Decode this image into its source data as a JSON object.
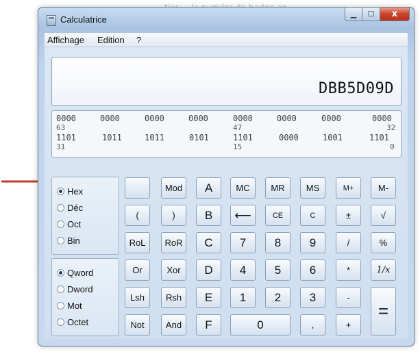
{
  "background_text": "tier ... le numéro de badge en ...",
  "window": {
    "title": "Calculatrice",
    "close_glyph": "x"
  },
  "menubar": [
    "Affichage",
    "Edition",
    "?"
  ],
  "display": {
    "value": "DBB5D09D"
  },
  "bits": {
    "row1": [
      "0000",
      "0000",
      "0000",
      "0000",
      "0000",
      "0000",
      "0000",
      "0000"
    ],
    "row1_pos": [
      "63",
      "47",
      "32"
    ],
    "row2": [
      "1101",
      "1011",
      "1011",
      "0101",
      "1101",
      "0000",
      "1001",
      "1101"
    ],
    "row2_pos": [
      "31",
      "15",
      "0"
    ]
  },
  "base_options": [
    {
      "label": "Hex",
      "selected": true
    },
    {
      "label": "Déc",
      "selected": false
    },
    {
      "label": "Oct",
      "selected": false
    },
    {
      "label": "Bin",
      "selected": false
    }
  ],
  "size_options": [
    {
      "label": "Qword",
      "selected": true
    },
    {
      "label": "Dword",
      "selected": false
    },
    {
      "label": "Mot",
      "selected": false
    },
    {
      "label": "Octet",
      "selected": false
    }
  ],
  "keys": {
    "blank": "",
    "mod": "Mod",
    "a": "A",
    "mc": "MC",
    "mr": "MR",
    "ms": "MS",
    "mplus": "M+",
    "mminus": "M-",
    "lparen": "(",
    "rparen": ")",
    "b": "B",
    "back": "⟵",
    "ce": "CE",
    "c": "C",
    "plusminus": "±",
    "sqrt": "√",
    "rol": "RoL",
    "ror": "RoR",
    "c_hex": "C",
    "seven": "7",
    "eight": "8",
    "nine": "9",
    "divide": "/",
    "percent": "%",
    "or": "Or",
    "xor": "Xor",
    "d": "D",
    "four": "4",
    "five": "5",
    "six": "6",
    "multiply": "*",
    "reciprocal": "1/x",
    "lsh": "Lsh",
    "rsh": "Rsh",
    "e": "E",
    "one": "1",
    "two": "2",
    "three": "3",
    "minus": "-",
    "equals": "=",
    "not": "Not",
    "and": "And",
    "f": "F",
    "zero": "0",
    "decimal": ",",
    "plus": "+"
  },
  "colors": {
    "arrow": "#c0392b"
  }
}
